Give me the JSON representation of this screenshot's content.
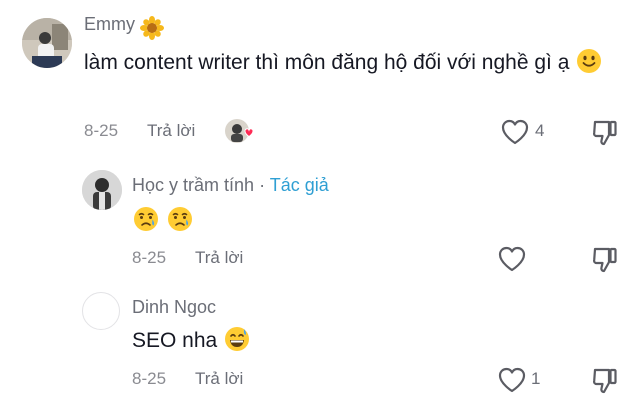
{
  "comments": [
    {
      "user": "Emmy",
      "text": "làm content writer thì môn đăng hộ đối với nghề gì ạ",
      "date": "8-25",
      "reply_label": "Trả lời",
      "likes": "4"
    }
  ],
  "replies": [
    {
      "user": "Học y trầm tính",
      "separator": "·",
      "author_tag": "Tác giả",
      "date": "8-25",
      "reply_label": "Trả lời",
      "likes": ""
    },
    {
      "user": "Dinh Ngoc",
      "text": "SEO nha",
      "date": "8-25",
      "reply_label": "Trả lời",
      "likes": "1"
    }
  ],
  "colors": {
    "author_tag": "#2f9fd3",
    "liked_heart": "#fe2c55",
    "emoji_face": "#ffcc33"
  }
}
